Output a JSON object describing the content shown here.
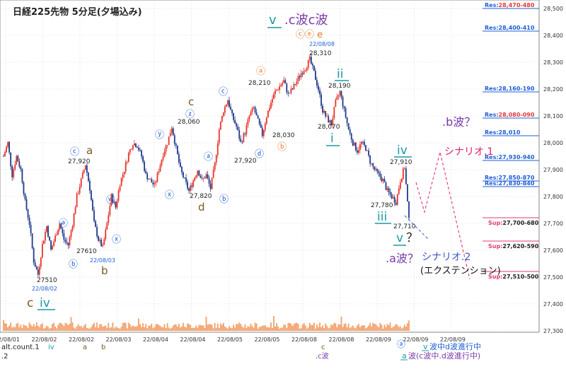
{
  "title": "日経225先物 5分足(夕場込み)",
  "colors": {
    "up": "#e8332a",
    "down": "#1e3a8a",
    "volume": "#f3a06a",
    "res": "#1f5fd6",
    "sup": "#e23a7a",
    "wave_blue": "#1c5fd6",
    "wave_orange": "#e8792a",
    "wave_brown": "#7a5a22",
    "wave_teal": "#1a9aa0",
    "wave_purple": "#7a3aa8",
    "scenario_red": "#e0226a",
    "scenario_blue": "#3a58c8"
  },
  "chart_data": {
    "type": "candlestick",
    "title": "日経225先物 5分足(夕場込み)",
    "ylim": [
      27300,
      28500
    ],
    "yticks": [
      27300,
      27400,
      27500,
      27600,
      27700,
      27800,
      27900,
      28000,
      28100,
      28200,
      28300,
      28400,
      28500
    ],
    "ytick_labels": [
      "27,300",
      "27,400",
      "27,500",
      "27,600",
      "27,700",
      "27,800",
      "27,900",
      "28,000",
      "28,100",
      "28,200",
      "28,300",
      "28,400",
      "28,500"
    ],
    "xtick_labels": [
      "22/08/01",
      "22/08/02",
      "22/08/02",
      "22/08/03",
      "22/08/04",
      "22/08/04",
      "22/08/05",
      "22/08/05",
      "22/08/08",
      "22/08/08",
      "22/08/09",
      "22/08/09",
      "22/08/09"
    ],
    "price_path": [
      [
        0,
        27950
      ],
      [
        3,
        28000
      ],
      [
        6,
        27880
      ],
      [
        9,
        27950
      ],
      [
        12,
        27900
      ],
      [
        15,
        27780
      ],
      [
        18,
        27700
      ],
      [
        21,
        27560
      ],
      [
        24,
        27510
      ],
      [
        27,
        27620
      ],
      [
        30,
        27690
      ],
      [
        33,
        27600
      ],
      [
        36,
        27650
      ],
      [
        39,
        27700
      ],
      [
        42,
        27640
      ],
      [
        45,
        27620
      ],
      [
        48,
        27700
      ],
      [
        51,
        27800
      ],
      [
        54,
        27860
      ],
      [
        57,
        27920
      ],
      [
        60,
        27830
      ],
      [
        63,
        27700
      ],
      [
        66,
        27640
      ],
      [
        69,
        27610
      ],
      [
        72,
        27700
      ],
      [
        75,
        27800
      ],
      [
        78,
        27760
      ],
      [
        81,
        27850
      ],
      [
        84,
        27900
      ],
      [
        87,
        27960
      ],
      [
        90,
        28000
      ],
      [
        93,
        27990
      ],
      [
        96,
        27950
      ],
      [
        99,
        27880
      ],
      [
        102,
        27860
      ],
      [
        105,
        27840
      ],
      [
        108,
        27900
      ],
      [
        111,
        27960
      ],
      [
        114,
        28000
      ],
      [
        117,
        28060
      ],
      [
        120,
        27980
      ],
      [
        123,
        27900
      ],
      [
        126,
        27860
      ],
      [
        129,
        27820
      ],
      [
        132,
        27860
      ],
      [
        135,
        27900
      ],
      [
        138,
        27860
      ],
      [
        141,
        27880
      ],
      [
        144,
        27830
      ],
      [
        147,
        27920
      ],
      [
        150,
        28050
      ],
      [
        153,
        28120
      ],
      [
        156,
        28160
      ],
      [
        159,
        28100
      ],
      [
        162,
        28060
      ],
      [
        165,
        28000
      ],
      [
        168,
        28040
      ],
      [
        171,
        28100
      ],
      [
        174,
        28130
      ],
      [
        177,
        28080
      ],
      [
        180,
        28030
      ],
      [
        183,
        28100
      ],
      [
        186,
        28150
      ],
      [
        189,
        28190
      ],
      [
        192,
        28210
      ],
      [
        195,
        28230
      ],
      [
        198,
        28180
      ],
      [
        201,
        28200
      ],
      [
        204,
        28230
      ],
      [
        207,
        28260
      ],
      [
        210,
        28280
      ],
      [
        213,
        28310
      ],
      [
        216,
        28260
      ],
      [
        219,
        28200
      ],
      [
        222,
        28120
      ],
      [
        225,
        28090
      ],
      [
        228,
        28070
      ],
      [
        231,
        28150
      ],
      [
        234,
        28190
      ],
      [
        237,
        28120
      ],
      [
        240,
        28050
      ],
      [
        243,
        28000
      ],
      [
        246,
        27970
      ],
      [
        249,
        28000
      ],
      [
        252,
        27980
      ],
      [
        255,
        27930
      ],
      [
        258,
        27900
      ],
      [
        261,
        27880
      ],
      [
        264,
        27860
      ],
      [
        267,
        27820
      ],
      [
        270,
        27800
      ],
      [
        273,
        27780
      ],
      [
        276,
        27860
      ],
      [
        279,
        27910
      ],
      [
        282,
        27710
      ]
    ],
    "candle_span": [
      0,
      282
    ],
    "volume_baseline": 27300
  },
  "price_labels": [
    {
      "text": "27510"
    },
    {
      "text": "22/08/02"
    },
    {
      "text": "27610"
    },
    {
      "text": "22/08/03"
    },
    {
      "text": "27,920"
    },
    {
      "text": "28,060"
    },
    {
      "text": "27,820"
    },
    {
      "text": "28,210"
    },
    {
      "text": "27,920"
    },
    {
      "text": "28,030"
    },
    {
      "text": "28,310"
    },
    {
      "text": "22/08/08"
    },
    {
      "text": "28,190"
    },
    {
      "text": "28,070"
    },
    {
      "text": "27,910"
    },
    {
      "text": "27,780"
    },
    {
      "text": "27,710"
    }
  ],
  "res_lines": [
    {
      "label": "Res:",
      "value": "28,470-480"
    },
    {
      "label": "Res:",
      "value": "28,400-410"
    },
    {
      "label": "Res:",
      "value": "28,160-190"
    },
    {
      "label": "Res:",
      "value": "28,080-090"
    },
    {
      "label": "Res:",
      "value": "28,010"
    },
    {
      "label": "Res:",
      "value": "27,930-940"
    },
    {
      "label": "Res:",
      "value": "27,850-870"
    },
    {
      "label": "Res:",
      "value": "27,830-840"
    }
  ],
  "sup_lines": [
    {
      "label": "Sup:",
      "value": "27,700-680"
    },
    {
      "label": "Sup:",
      "value": "27,620-590"
    },
    {
      "label": "Sup:",
      "value": "27,510-500"
    }
  ],
  "waves": {
    "a": "ⓐ",
    "b": "ⓑ",
    "c": "ⓒ",
    "e": "ⓔ",
    "v": "ⓥ",
    "w": "ⓦ",
    "x": "ⓧ",
    "y": "ⓨ",
    "z": "ⓩ",
    "c_small": "c",
    "a_small": "a",
    "b_small": "b",
    "d_small": "d",
    "e_small": "e",
    "iv": "iv",
    "ii": "ii",
    "i": "i",
    "iii": "iii",
    "v_roman": "v",
    "c_iv_c": "c",
    "c_iv_iv": "iv"
  },
  "top_label": {
    "v": "v",
    "rest": ".c波c波"
  },
  "top_circles": "ⓒⓔ e",
  "annotations": {
    "b_wave_q": ".b波？",
    "a_wave_q": ".a波？",
    "scenario1": "シナリオ.1",
    "scenario2": "シナリオ.2",
    "extension": "(エクステンション)",
    "v_q": "v？"
  },
  "footer": {
    "left1": "alt.count.1",
    "left1_iv": "iv",
    "left1_a": "a",
    "left1_b": "b",
    "left2": ".2",
    "left2_c": "c",
    "left2_cwave": ".c波",
    "right1_circle": "ⓐ",
    "right1_v": "v",
    "right1_text": "波中d波進行中",
    "right2_a": "a",
    "right2_text": "波(c波中.d波進行中)"
  }
}
